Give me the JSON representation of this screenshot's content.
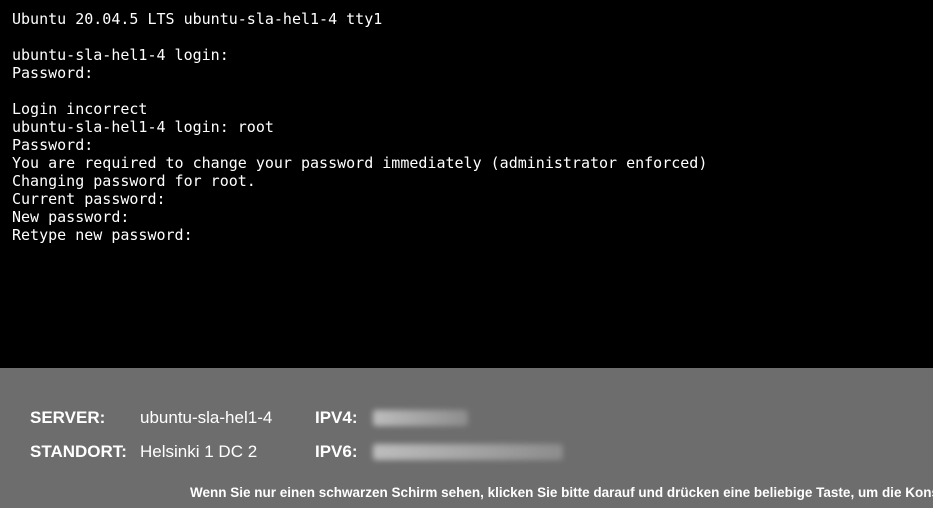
{
  "console": {
    "banner": "Ubuntu 20.04.5 LTS ubuntu-sla-hel1-4 tty1",
    "login_prompt_1": "ubuntu-sla-hel1-4 login:",
    "password_prompt_1": "Password:",
    "login_incorrect": "Login incorrect",
    "login_prompt_2": "ubuntu-sla-hel1-4 login: root",
    "password_prompt_2": "Password:",
    "change_required": "You are required to change your password immediately (administrator enforced)",
    "changing_for": "Changing password for root.",
    "current_pw": "Current password:",
    "new_pw": "New password:",
    "retype_pw": "Retype new password:"
  },
  "status": {
    "server_label": "SERVER:",
    "server_value": "ubuntu-sla-hel1-4",
    "location_label": "STANDORT:",
    "location_value": "Helsinki 1 DC 2",
    "ipv4_label": "IPV4:",
    "ipv6_label": "IPV6:",
    "hint": "Wenn Sie nur einen schwarzen Schirm sehen, klicken Sie bitte darauf und drücken eine beliebige Taste, um die Konsole zu al"
  }
}
